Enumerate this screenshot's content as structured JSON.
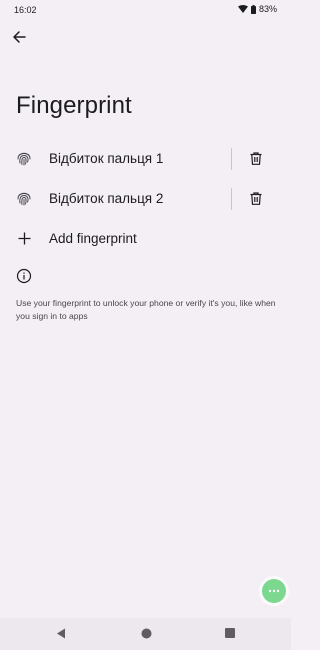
{
  "status_bar": {
    "time": "16:02",
    "battery": "83%"
  },
  "page": {
    "title": "Fingerprint"
  },
  "fingerprints": [
    {
      "label": "Відбиток пальця 1"
    },
    {
      "label": "Відбиток пальця 2"
    }
  ],
  "add_item": {
    "label": "Add fingerprint"
  },
  "info": {
    "text": "Use your fingerprint to unlock your phone or verify it's you, like when you sign in to apps"
  },
  "colors": {
    "background": "#f3eff5",
    "fab": "#7dd88f",
    "text_primary": "#1c1b1f",
    "text_secondary": "#49454f"
  }
}
